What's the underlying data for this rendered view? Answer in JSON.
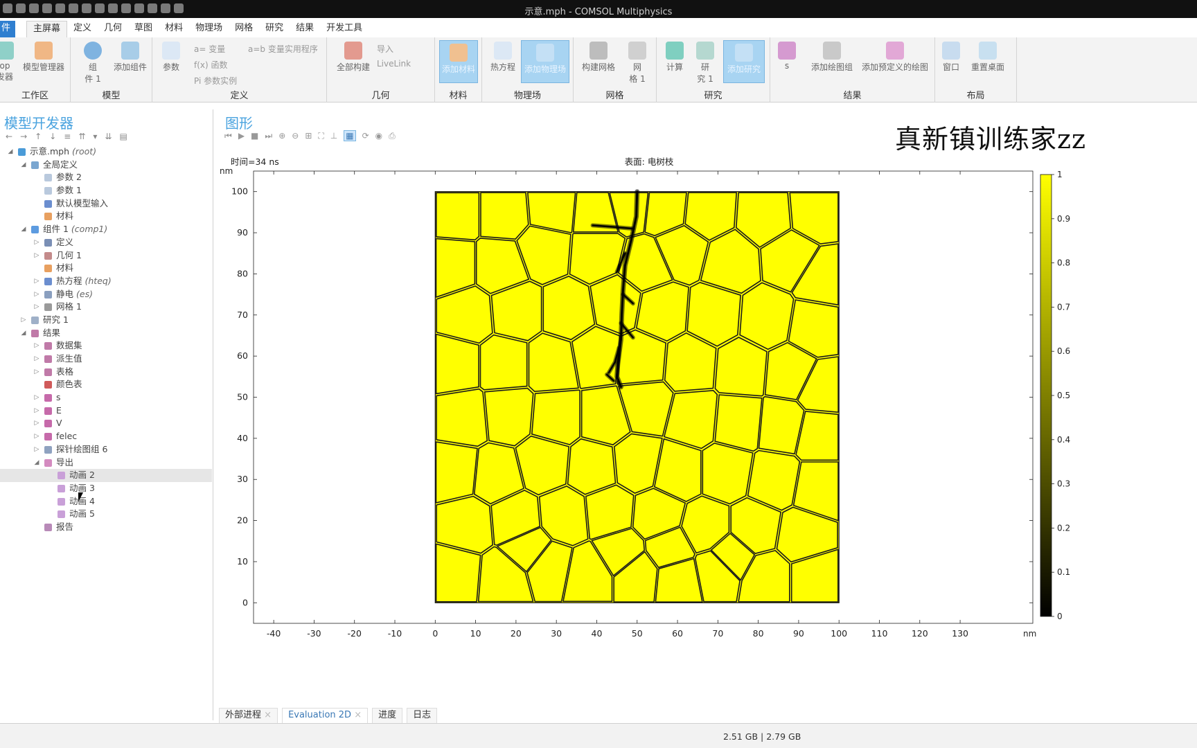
{
  "window_title": "示意.mph - COMSOL Multiphysics",
  "menu": {
    "file": "件",
    "tabs": [
      "主屏幕",
      "定义",
      "几何",
      "草图",
      "材料",
      "物理场",
      "网格",
      "研究",
      "结果",
      "开发工具"
    ]
  },
  "ribbon": {
    "groups": {
      "workspace": "工作区",
      "model": "模型",
      "definitions": "定义",
      "geometry": "几何",
      "materials": "材料",
      "physics": "物理场",
      "mesh": "网格",
      "study": "研究",
      "results": "结果",
      "layout": "布局"
    },
    "app_builder": "op\n发器",
    "model_manager": "模型管理器",
    "component": "组\n件 1",
    "add_component": "添加组件",
    "parameters": "参数",
    "variables": "a= 变量",
    "functions": "f(x) 函数",
    "param_case": "Pi 参数实例",
    "var_utilities": "a=b 变量实用程序",
    "build_all": "全部构建",
    "import": "导入",
    "livelink": "LiveLink",
    "add_material": "添加材料",
    "heat_equation": "热方程",
    "add_physics": "添加物理场",
    "build_mesh": "构建网格",
    "mesh1": "网\n格 1",
    "compute": "计算",
    "study1": "研\n究 1",
    "add_study": "添加研究",
    "s": "s",
    "add_plot_group": "添加绘图组",
    "add_predefined_plot": "添加预定义的绘图",
    "window": "窗口",
    "reset_desktop": "重置桌面"
  },
  "model_builder": {
    "title": "模型开发器",
    "tree": [
      {
        "label": "示意.mph",
        "tag": "(root)",
        "level": 0,
        "exp": "◢",
        "color": "#4a9bd8"
      },
      {
        "label": "全局定义",
        "tag": "",
        "level": 1,
        "exp": "◢",
        "color": "#7aa6d0"
      },
      {
        "label": "参数 2",
        "tag": "",
        "level": 2,
        "exp": "",
        "color": "#b9c9dd"
      },
      {
        "label": "参数 1",
        "tag": "",
        "level": 2,
        "exp": "",
        "color": "#b9c9dd"
      },
      {
        "label": "默认模型输入",
        "tag": "",
        "level": 2,
        "exp": "",
        "color": "#6b8ecf"
      },
      {
        "label": "材料",
        "tag": "",
        "level": 2,
        "exp": "",
        "color": "#e8a060"
      },
      {
        "label": "组件 1",
        "tag": "(comp1)",
        "level": 1,
        "exp": "◢",
        "color": "#5d9be0"
      },
      {
        "label": "定义",
        "tag": "",
        "level": 2,
        "exp": "▷",
        "color": "#7a8fb5"
      },
      {
        "label": "几何 1",
        "tag": "",
        "level": 2,
        "exp": "▷",
        "color": "#c48b8b"
      },
      {
        "label": "材料",
        "tag": "",
        "level": 2,
        "exp": "",
        "color": "#e8a060"
      },
      {
        "label": "热方程",
        "tag": "(hteq)",
        "level": 2,
        "exp": "▷",
        "color": "#6b8ecf"
      },
      {
        "label": "静电",
        "tag": "(es)",
        "level": 2,
        "exp": "▷",
        "color": "#8a9fbf"
      },
      {
        "label": "网格 1",
        "tag": "",
        "level": 2,
        "exp": "▷",
        "color": "#9a9a9a"
      },
      {
        "label": "研究 1",
        "tag": "",
        "level": 1,
        "exp": "▷",
        "color": "#9fb0c8"
      },
      {
        "label": "结果",
        "tag": "",
        "level": 1,
        "exp": "◢",
        "color": "#c07aa8"
      },
      {
        "label": "数据集",
        "tag": "",
        "level": 2,
        "exp": "▷",
        "color": "#c07aa8"
      },
      {
        "label": "派生值",
        "tag": "",
        "level": 2,
        "exp": "▷",
        "color": "#c07aa8"
      },
      {
        "label": "表格",
        "tag": "",
        "level": 2,
        "exp": "▷",
        "color": "#c07aa8"
      },
      {
        "label": "颜色表",
        "tag": "",
        "level": 2,
        "exp": "",
        "color": "#d05a5a"
      },
      {
        "label": "s",
        "tag": "",
        "level": 2,
        "exp": "▷",
        "color": "#c66aaa"
      },
      {
        "label": "E",
        "tag": "",
        "level": 2,
        "exp": "▷",
        "color": "#c66aaa"
      },
      {
        "label": "V",
        "tag": "",
        "level": 2,
        "exp": "▷",
        "color": "#c66aaa"
      },
      {
        "label": "felec",
        "tag": "",
        "level": 2,
        "exp": "▷",
        "color": "#c66aaa"
      },
      {
        "label": "探针绘图组 6",
        "tag": "",
        "level": 2,
        "exp": "▷",
        "color": "#8fa2c0"
      },
      {
        "label": "导出",
        "tag": "",
        "level": 2,
        "exp": "◢",
        "color": "#d48bc0"
      },
      {
        "label": "动画 2",
        "tag": "",
        "level": 3,
        "exp": "",
        "color": "#c9a0d8",
        "selected": true
      },
      {
        "label": "动画 3",
        "tag": "",
        "level": 3,
        "exp": "",
        "color": "#c9a0d8"
      },
      {
        "label": "动画 4",
        "tag": "",
        "level": 3,
        "exp": "",
        "color": "#c9a0d8"
      },
      {
        "label": "动画 5",
        "tag": "",
        "level": 3,
        "exp": "",
        "color": "#c9a0d8"
      },
      {
        "label": "报告",
        "tag": "",
        "level": 2,
        "exp": "",
        "color": "#b88ab8"
      }
    ]
  },
  "graphics": {
    "title": "图形",
    "watermark": "真新镇训练家zz"
  },
  "chart_data": {
    "type": "heatmap",
    "title_left": "时间=34 ns",
    "title_center": "表面: 电树枝",
    "xunit": "nm",
    "yunit": "nm",
    "xlim": [
      -45,
      148
    ],
    "ylim": [
      -5,
      105
    ],
    "xticks": [
      -40,
      -30,
      -20,
      -10,
      0,
      10,
      20,
      30,
      40,
      50,
      60,
      70,
      80,
      90,
      100,
      110,
      120,
      130
    ],
    "yticks": [
      0,
      10,
      20,
      30,
      40,
      50,
      60,
      70,
      80,
      90,
      100
    ],
    "domain": {
      "x": [
        0,
        100
      ],
      "y": [
        0,
        100
      ]
    },
    "colorbar": {
      "min": 0,
      "max": 1,
      "ticks": [
        0,
        0.1,
        0.2,
        0.3,
        0.4,
        0.5,
        0.6,
        0.7,
        0.8,
        0.9,
        1
      ],
      "colors": [
        "#000000",
        "#ffff00"
      ]
    },
    "field_color": "#ffff00",
    "grain_seeds": [
      [
        5,
        95
      ],
      [
        17,
        95
      ],
      [
        29,
        96
      ],
      [
        40,
        95
      ],
      [
        48,
        97
      ],
      [
        57,
        96
      ],
      [
        67,
        95
      ],
      [
        82,
        94
      ],
      [
        94,
        95
      ],
      [
        4,
        82
      ],
      [
        16,
        82
      ],
      [
        27,
        86
      ],
      [
        40,
        85
      ],
      [
        52,
        82
      ],
      [
        61,
        86
      ],
      [
        73,
        83
      ],
      [
        88,
        84
      ],
      [
        96,
        79
      ],
      [
        8,
        70
      ],
      [
        20,
        71
      ],
      [
        33,
        71
      ],
      [
        45,
        73
      ],
      [
        56,
        71
      ],
      [
        69,
        70
      ],
      [
        82,
        69
      ],
      [
        94,
        67
      ],
      [
        5,
        58
      ],
      [
        17,
        58
      ],
      [
        29,
        58
      ],
      [
        40,
        60
      ],
      [
        51,
        59
      ],
      [
        63,
        58
      ],
      [
        76,
        57
      ],
      [
        88,
        56
      ],
      [
        96,
        52
      ],
      [
        7,
        45
      ],
      [
        18,
        46
      ],
      [
        30,
        45
      ],
      [
        42,
        45
      ],
      [
        52,
        48
      ],
      [
        64,
        45
      ],
      [
        75,
        44
      ],
      [
        86,
        43
      ],
      [
        95,
        41
      ],
      [
        5,
        32
      ],
      [
        15,
        31
      ],
      [
        27,
        34
      ],
      [
        39,
        33
      ],
      [
        50,
        34
      ],
      [
        60,
        32
      ],
      [
        72,
        32
      ],
      [
        84,
        30
      ],
      [
        95,
        28
      ],
      [
        8,
        19
      ],
      [
        20,
        20
      ],
      [
        32,
        21
      ],
      [
        43,
        22
      ],
      [
        55,
        21
      ],
      [
        67,
        18
      ],
      [
        79,
        18
      ],
      [
        91,
        16
      ],
      [
        5,
        7
      ],
      [
        17,
        6
      ],
      [
        28,
        9
      ],
      [
        38,
        7
      ],
      [
        50,
        7
      ],
      [
        60,
        6
      ],
      [
        70,
        8
      ],
      [
        82,
        6
      ],
      [
        94,
        6
      ],
      [
        23,
        13
      ],
      [
        46,
        12
      ],
      [
        58,
        13
      ],
      [
        73,
        11
      ]
    ],
    "tree_trunk": [
      [
        50,
        100
      ],
      [
        49.8,
        94
      ],
      [
        48.5,
        88
      ],
      [
        47,
        82
      ],
      [
        46.5,
        76
      ],
      [
        46.2,
        70
      ],
      [
        46,
        64
      ],
      [
        45.2,
        58
      ],
      [
        45,
        55
      ],
      [
        46,
        52.5
      ]
    ],
    "tree_branches": [
      [
        [
          49,
          91
        ],
        [
          43,
          91.5
        ],
        [
          39,
          91.8
        ]
      ],
      [
        [
          47,
          85
        ],
        [
          45,
          80.5
        ]
      ],
      [
        [
          46.5,
          75
        ],
        [
          49,
          72.8
        ]
      ],
      [
        [
          46,
          68
        ],
        [
          49,
          64.5
        ]
      ],
      [
        [
          45.5,
          62
        ],
        [
          44.5,
          58.5
        ],
        [
          43,
          56
        ]
      ],
      [
        [
          44.2,
          54
        ],
        [
          42.5,
          55.5
        ]
      ]
    ]
  },
  "bottom_tabs": [
    "外部进程",
    "Evaluation 2D",
    "进度",
    "日志"
  ],
  "status": {
    "memory": "2.51 GB | 2.79 GB"
  }
}
